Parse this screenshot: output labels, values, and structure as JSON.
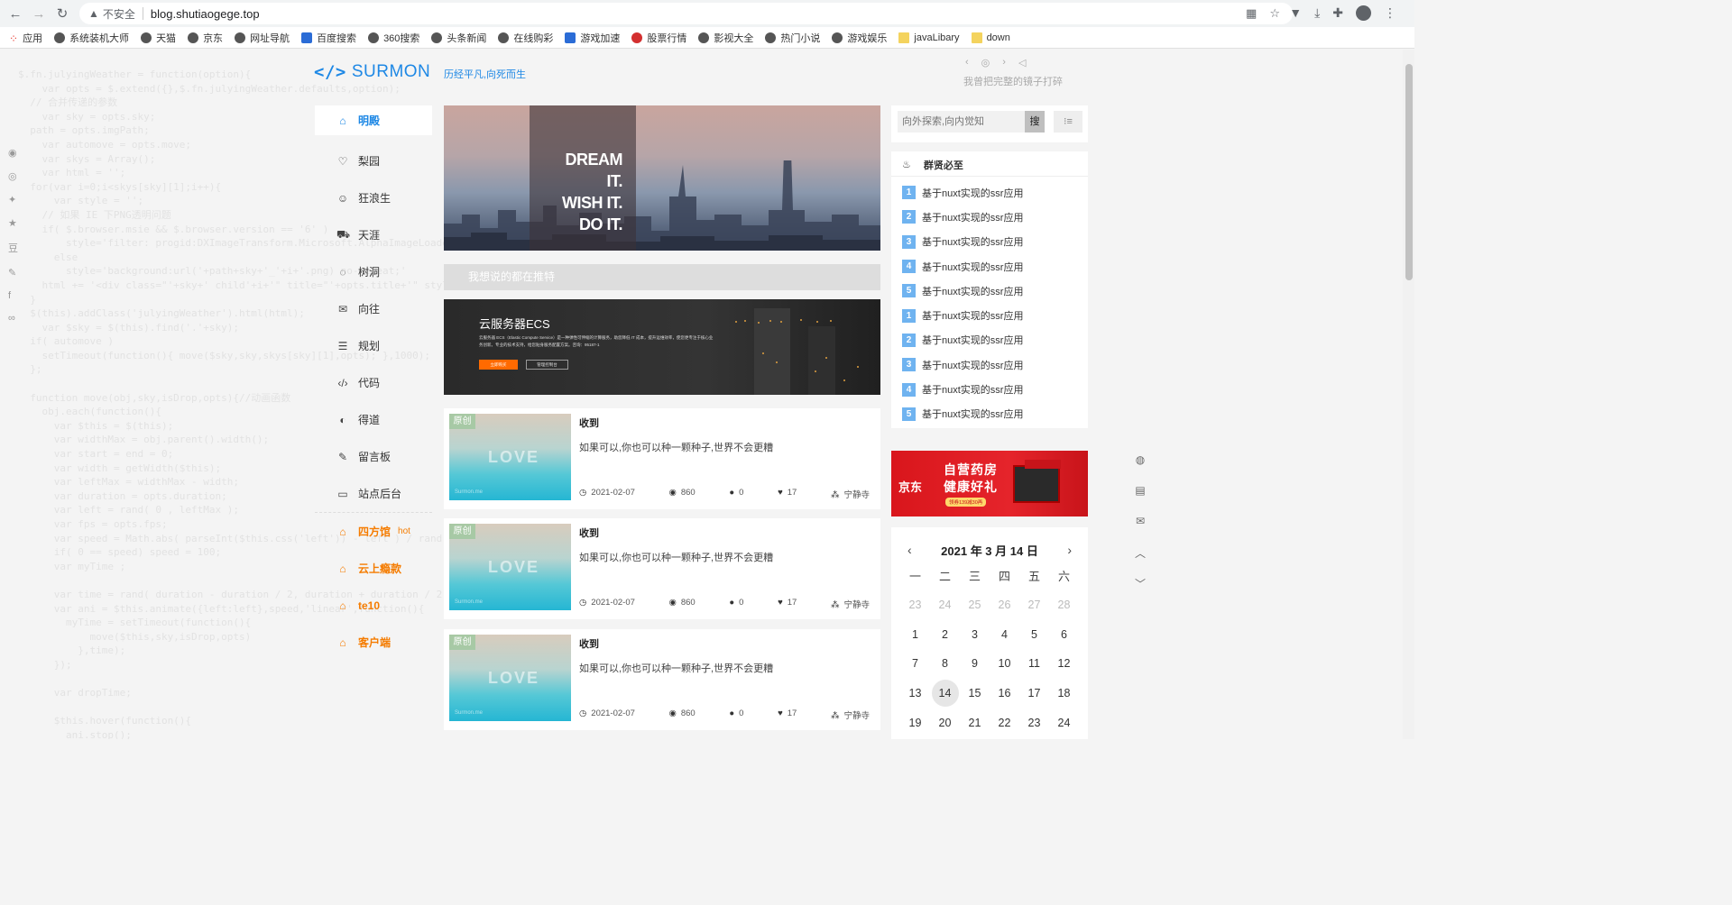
{
  "browser": {
    "insecure_label": "不安全",
    "url": "blog.shutiaogege.top"
  },
  "bookmarks": [
    {
      "label": "应用",
      "icon": "apps-grid-icon"
    },
    {
      "label": "系统装机大师",
      "icon": "globe-icon"
    },
    {
      "label": "天猫",
      "icon": "globe-icon"
    },
    {
      "label": "京东",
      "icon": "globe-icon"
    },
    {
      "label": "网址导航",
      "icon": "globe-icon"
    },
    {
      "label": "百度搜索",
      "icon": "baidu-paw-icon"
    },
    {
      "label": "360搜索",
      "icon": "globe-icon"
    },
    {
      "label": "头条新闻",
      "icon": "globe-icon"
    },
    {
      "label": "在线购彩",
      "icon": "globe-icon"
    },
    {
      "label": "游戏加速",
      "icon": "blue-app-icon"
    },
    {
      "label": "股票行情",
      "icon": "red-app-icon"
    },
    {
      "label": "影视大全",
      "icon": "globe-icon"
    },
    {
      "label": "热门小说",
      "icon": "globe-icon"
    },
    {
      "label": "游戏娱乐",
      "icon": "gamepad-icon"
    },
    {
      "label": "javaLibary",
      "icon": "folder-icon"
    },
    {
      "label": "down",
      "icon": "folder-icon"
    }
  ],
  "site": {
    "logo_mark": "</>",
    "logo_text": "SURMON",
    "tagline": "历经平凡,向死而生",
    "player_text": "我曾把完整的镜子打碎"
  },
  "nav": [
    {
      "label": "明殿",
      "icon": "home-icon",
      "style": "active"
    },
    {
      "label": "梨园",
      "icon": "heart-icon",
      "style": ""
    },
    {
      "label": "狂浪生",
      "icon": "smile-icon",
      "style": ""
    },
    {
      "label": "天涯",
      "icon": "car-icon",
      "style": ""
    },
    {
      "label": "树洞",
      "icon": "chat-bubble-icon",
      "style": ""
    },
    {
      "label": "向往",
      "icon": "comment-icon",
      "style": ""
    },
    {
      "label": "规划",
      "icon": "list-icon",
      "style": ""
    },
    {
      "label": "代码",
      "icon": "code-icon",
      "style": ""
    },
    {
      "label": "得道",
      "icon": "palette-icon",
      "style": ""
    },
    {
      "label": "留言板",
      "icon": "edit-icon",
      "style": ""
    },
    {
      "label": "站点后台",
      "icon": "monitor-icon",
      "style": ""
    },
    {
      "label": "四方馆",
      "icon": "home-icon",
      "style": "orange",
      "badge": "hot"
    },
    {
      "label": "云上瘾款",
      "icon": "home-icon",
      "style": "orange"
    },
    {
      "label": "te10",
      "icon": "home-icon",
      "style": "orange"
    },
    {
      "label": "客户端",
      "icon": "home-icon",
      "style": "orange"
    }
  ],
  "banner": {
    "line1": "DREAM IT.",
    "line2": "WISH IT.",
    "line3": "DO IT."
  },
  "recommend_bar": "我想说的都在推特",
  "ecs_ad": {
    "title": "云服务器ECS",
    "desc": "云服务器 ECS（Elastic Compute Service）是一种弹性可伸缩的计算服务，助您降低 IT 成本，提升运维效率，使您更专注于核心业务创新。专业的技术支持，给您贴身服务配置方案。咨询：95187-1",
    "btn1": "立即购买",
    "btn2": "管理控制台"
  },
  "posts": [
    {
      "badge": "原创",
      "thumb_text": "LOVE",
      "thumb_watermark": "Surmon.me",
      "title": "收到",
      "excerpt": "如果可以,你也可以种一颗种子,世界不会更糟",
      "date": "2021-02-07",
      "views": "860",
      "comments": "0",
      "likes": "17",
      "category": "宁静寺"
    },
    {
      "badge": "原创",
      "thumb_text": "LOVE",
      "thumb_watermark": "Surmon.me",
      "title": "收到",
      "excerpt": "如果可以,你也可以种一颗种子,世界不会更糟",
      "date": "2021-02-07",
      "views": "860",
      "comments": "0",
      "likes": "17",
      "category": "宁静寺"
    },
    {
      "badge": "原创",
      "thumb_text": "LOVE",
      "thumb_watermark": "Surmon.me",
      "title": "收到",
      "excerpt": "如果可以,你也可以种一颗种子,世界不会更糟",
      "date": "2021-02-07",
      "views": "860",
      "comments": "0",
      "likes": "17",
      "category": "宁静寺"
    }
  ],
  "search": {
    "placeholder": "向外探索,向内觉知",
    "button": "搜"
  },
  "hotlist": {
    "title": "群贤必至",
    "items": [
      {
        "num": "1",
        "label": "基于nuxt实现的ssr应用"
      },
      {
        "num": "2",
        "label": "基于nuxt实现的ssr应用"
      },
      {
        "num": "3",
        "label": "基于nuxt实现的ssr应用"
      },
      {
        "num": "4",
        "label": "基于nuxt实现的ssr应用"
      },
      {
        "num": "5",
        "label": "基于nuxt实现的ssr应用"
      },
      {
        "num": "1",
        "label": "基于nuxt实现的ssr应用"
      },
      {
        "num": "2",
        "label": "基于nuxt实现的ssr应用"
      },
      {
        "num": "3",
        "label": "基于nuxt实现的ssr应用"
      },
      {
        "num": "4",
        "label": "基于nuxt实现的ssr应用"
      },
      {
        "num": "5",
        "label": "基于nuxt实现的ssr应用"
      }
    ]
  },
  "jd_ad": {
    "brand": "京东",
    "line1": "自营药房",
    "line2": "健康好礼",
    "line3": "领券139减30再"
  },
  "calendar": {
    "title": "2021 年 3 月 14 日",
    "weekdays": [
      "一",
      "二",
      "三",
      "四",
      "五",
      "六"
    ],
    "rows": [
      [
        "23",
        "24",
        "25",
        "26",
        "27",
        "28"
      ],
      [
        "1",
        "2",
        "3",
        "4",
        "5",
        "6"
      ],
      [
        "7",
        "8",
        "9",
        "10",
        "11",
        "12"
      ],
      [
        "13",
        "14",
        "15",
        "16",
        "17",
        "18"
      ],
      [
        "19",
        "20",
        "21",
        "22",
        "23",
        "24"
      ]
    ],
    "today": "14"
  },
  "colors": {
    "accent": "#1e88e5",
    "orange": "#f57c00",
    "hot_num": "#6fb3f0"
  }
}
